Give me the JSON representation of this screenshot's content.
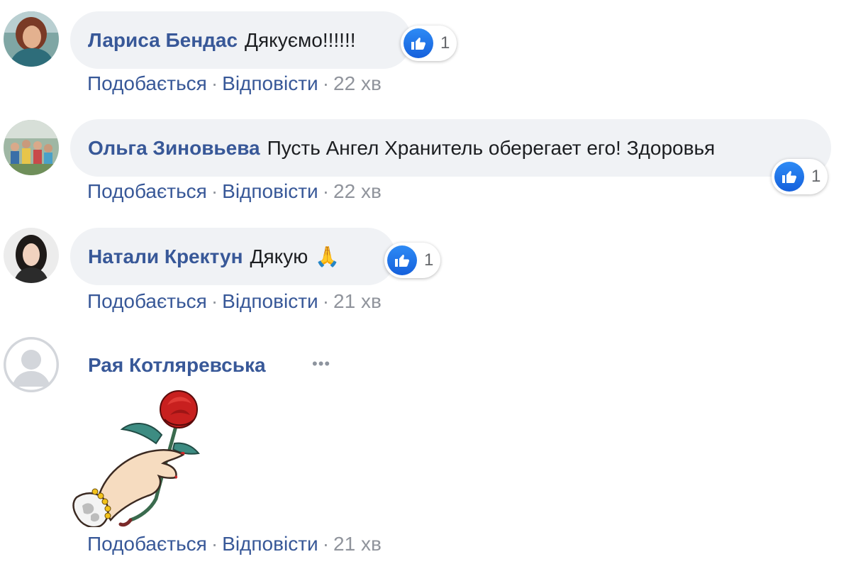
{
  "actions": {
    "like": "Подобається",
    "reply": "Відповісти",
    "separator": "·"
  },
  "comments": [
    {
      "author": "Лариса Бендас",
      "text": "Дякуємо!!!!!!",
      "likes": "1",
      "time": "22 хв"
    },
    {
      "author": "Ольга Зиновьева",
      "text": "Пусть Ангел Хранитель оберегает его! Здоровья",
      "likes": "1",
      "time": "22 хв"
    },
    {
      "author": "Натали Кректун",
      "text": "Дякую",
      "emoji": "🙏",
      "likes": "1",
      "time": "21 хв"
    },
    {
      "author": "Рая Котляревська",
      "sticker": "hand-holding-rose",
      "more": "•••",
      "time": "21 хв"
    }
  ]
}
